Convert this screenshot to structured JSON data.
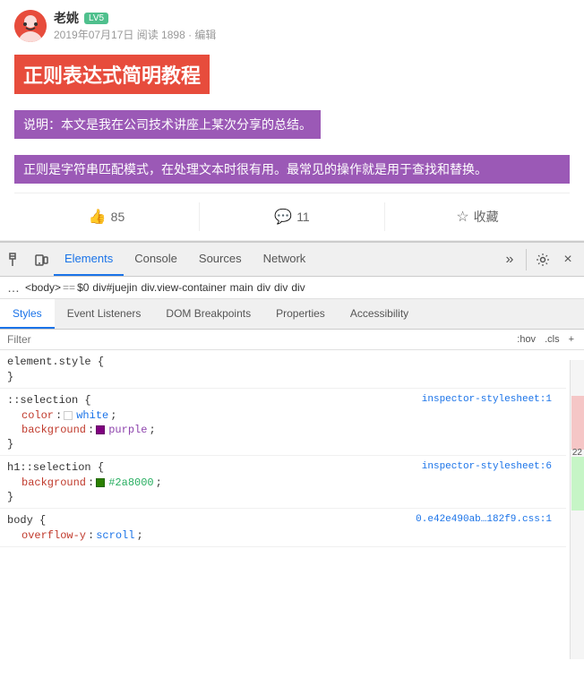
{
  "author": {
    "name": "老姚",
    "level": "LV5",
    "meta": "2019年07月17日  阅读 1898 · 编辑"
  },
  "article": {
    "title": "正则表达式简明教程",
    "note": "说明：本文是我在公司技术讲座上某次分享的总结。",
    "desc": "正则是字符串匹配模式，在处理文本时很有用。最常见的操作就是用于查找和替换。"
  },
  "actions": {
    "like_count": "85",
    "comment_count": "11",
    "collect_label": "收藏"
  },
  "devtools": {
    "tabs": [
      "Elements",
      "Console",
      "Sources",
      "Network"
    ],
    "active_tab": "Elements",
    "close_label": "×",
    "more_label": "»"
  },
  "breadcrumb": {
    "items": [
      "<body>",
      "==",
      "$0",
      "div#juejin",
      "div.view-container",
      "main",
      "div",
      "div",
      "div"
    ]
  },
  "subtabs": {
    "items": [
      "Styles",
      "Event Listeners",
      "DOM Breakpoints",
      "Properties",
      "Accessibility"
    ],
    "active": "Styles"
  },
  "filter": {
    "placeholder": "Filter",
    "hov_label": ":hov",
    "cls_label": ".cls",
    "add_label": "+"
  },
  "css_blocks": [
    {
      "id": "element_style",
      "selector": "element.style {",
      "close": "}",
      "props": []
    },
    {
      "id": "selection",
      "selector": "::selection {",
      "close": "}",
      "source": "inspector-stylesheet:1",
      "props": [
        {
          "name": "color",
          "value": "white",
          "swatch": null
        },
        {
          "name": "background",
          "value": "purple",
          "swatch": "#800080"
        }
      ]
    },
    {
      "id": "h1_selection",
      "selector": "h1::selection {",
      "close": "}",
      "source": "inspector-stylesheet:6",
      "props": [
        {
          "name": "background",
          "value": "#2a8000",
          "swatch": "#2a8000"
        }
      ]
    },
    {
      "id": "body",
      "selector": "body {",
      "close": "}",
      "source": "0.e42e490ab…182f9.css:1",
      "props": [
        {
          "name": "overflow-y",
          "value": "scroll"
        }
      ]
    }
  ],
  "line_numbers": {
    "n22": "22"
  }
}
